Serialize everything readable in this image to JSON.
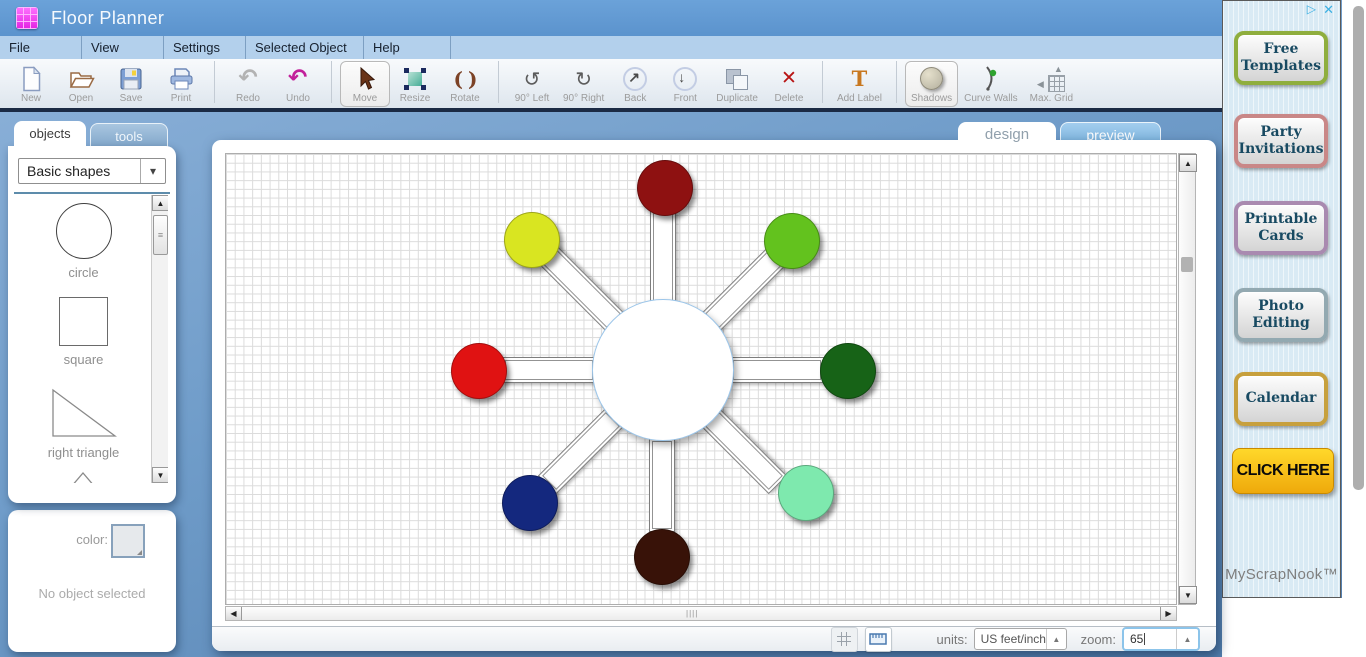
{
  "window": {
    "title": "Floor Planner"
  },
  "menubar": {
    "items": [
      "File",
      "View",
      "Settings",
      "Selected Object",
      "Help"
    ]
  },
  "toolbar": {
    "groups": [
      {
        "items": [
          {
            "id": "new",
            "label": "New"
          },
          {
            "id": "open",
            "label": "Open"
          },
          {
            "id": "save",
            "label": "Save"
          },
          {
            "id": "print",
            "label": "Print"
          }
        ]
      },
      {
        "items": [
          {
            "id": "redo",
            "label": "Redo"
          },
          {
            "id": "undo",
            "label": "Undo"
          }
        ]
      },
      {
        "items": [
          {
            "id": "move",
            "label": "Move",
            "selected": true
          },
          {
            "id": "resize",
            "label": "Resize"
          },
          {
            "id": "rotate",
            "label": "Rotate"
          }
        ]
      },
      {
        "items": [
          {
            "id": "rotate-90-left",
            "label": "90° Left"
          },
          {
            "id": "rotate-90-right",
            "label": "90° Right"
          },
          {
            "id": "back",
            "label": "Back"
          },
          {
            "id": "front",
            "label": "Front"
          },
          {
            "id": "duplicate",
            "label": "Duplicate"
          },
          {
            "id": "delete",
            "label": "Delete"
          }
        ]
      },
      {
        "items": [
          {
            "id": "add-label",
            "label": "Add Label"
          }
        ]
      },
      {
        "items": [
          {
            "id": "shadows",
            "label": "Shadows",
            "selected": true
          },
          {
            "id": "curve-walls",
            "label": "Curve Walls"
          },
          {
            "id": "max-grid",
            "label": "Max. Grid"
          }
        ]
      }
    ]
  },
  "icons": {
    "dropdown_down": "▾",
    "spinner_up": "▲",
    "scroll_up": "▲",
    "scroll_down": "▼",
    "scroll_left": "◀",
    "scroll_right": "▶",
    "thumb_grip": "≡",
    "h_grip": "||||",
    "redo": "↶",
    "undo": "↷",
    "rotate_left": "↺",
    "rotate_right": "↻",
    "back": "↗",
    "front": "↓",
    "delete": "✕",
    "add_label": "T",
    "rotate_parens": "( )",
    "tri_up": "▲",
    "tri_left": "◀",
    "adchoices": "▷",
    "ad_close": "✕"
  },
  "sidebar": {
    "tabs": [
      {
        "label": "objects",
        "active": true
      },
      {
        "label": "tools",
        "active": false
      }
    ],
    "category_dropdown": {
      "value": "Basic shapes"
    },
    "shapes": [
      {
        "name": "circle",
        "label": "circle"
      },
      {
        "name": "square",
        "label": "square"
      },
      {
        "name": "right-triangle",
        "label": "right triangle"
      }
    ],
    "color_panel": {
      "label": "color:",
      "empty_text": "No object selected"
    }
  },
  "canvas": {
    "tabs": [
      {
        "label": "design",
        "active": true
      },
      {
        "label": "preview",
        "active": false
      }
    ],
    "statusbar": {
      "units_label": "units:",
      "units_value": "US feet/inch",
      "zoom_label": "zoom:",
      "zoom_value": "65"
    }
  },
  "figure": {
    "center": {
      "fill": "#ffffff",
      "border": "#9cc6ea"
    },
    "nodes": [
      {
        "dir": "n",
        "color": "#8e1111"
      },
      {
        "dir": "ne",
        "color": "#63c21e"
      },
      {
        "dir": "e",
        "color": "#176317"
      },
      {
        "dir": "se",
        "color": "#7ee9ae"
      },
      {
        "dir": "s",
        "color": "#381208"
      },
      {
        "dir": "sw",
        "color": "#14287e"
      },
      {
        "dir": "w",
        "color": "#e01212"
      },
      {
        "dir": "nw",
        "color": "#d9e521"
      }
    ]
  },
  "ad": {
    "buttons": [
      {
        "label": "Free Templates",
        "border_color": "#8fae3e"
      },
      {
        "label": "Party Invitations",
        "border_color": "#c98787"
      },
      {
        "label": "Printable Cards",
        "border_color": "#a98ab0"
      },
      {
        "label": "Photo Editing",
        "border_color": "#93a9b1"
      },
      {
        "label": "Calendar",
        "border_color": "#c7a03d"
      }
    ],
    "cta_label": "CLICK HERE",
    "brand": "MyScrapNook™"
  }
}
